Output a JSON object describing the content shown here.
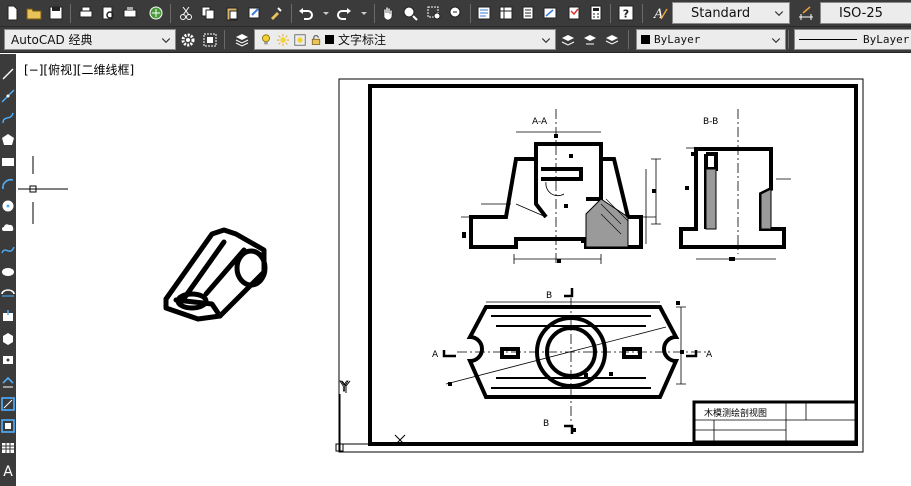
{
  "toolbar_top": {
    "text_style": "Standard",
    "dim_style": "ISO-25",
    "icons": [
      "new-icon",
      "open-icon",
      "save-icon",
      "print-icon",
      "print-preview-icon",
      "plot-icon",
      "publish-icon",
      "cut-icon",
      "copy-icon",
      "paste-icon",
      "match-properties-icon",
      "undo-icon",
      "redo-icon",
      "pan-icon",
      "zoom-realtime-icon",
      "zoom-window-icon",
      "zoom-previous-icon",
      "properties-icon",
      "design-center-icon",
      "tool-palettes-icon",
      "sheet-set-icon",
      "markup-icon",
      "calculator-icon",
      "help-icon",
      "text-style-icon",
      "dim-style-icon"
    ]
  },
  "toolbar_second": {
    "workspace": "AutoCAD 经典",
    "layer": "文字标注",
    "color": "ByLayer",
    "linetype": "ByLayer",
    "icons": [
      "settings-gear-icon",
      "workspace-icon",
      "layer-manager-icon",
      "layer-light-icon",
      "layer-sun-icon",
      "layer-lock-icon",
      "layer-color-icon",
      "make-current-icon",
      "layer-previous-icon",
      "layer-state-icon",
      "color-swatch-icon",
      "linetype-icon"
    ]
  },
  "left_toolbar": {
    "icons": [
      "line-icon",
      "construction-line-icon",
      "polyline-icon",
      "polygon-icon",
      "rectangle-icon",
      "arc-icon",
      "circle-icon",
      "revision-cloud-icon",
      "spline-icon",
      "ellipse-icon",
      "ellipse-arc-icon",
      "insert-block-icon",
      "make-block-icon",
      "point-icon",
      "hatch-icon",
      "gradient-icon",
      "region-icon",
      "table-icon",
      "multiline-text-icon"
    ]
  },
  "canvas": {
    "view_label": "[−][俯视][二维线框]",
    "section_aa": "A-A",
    "section_bb": "B-B",
    "cut_a_left": "A",
    "cut_a_right": "A",
    "cut_b_top": "B",
    "cut_b_bottom": "B",
    "title_block_name": "木模测绘剖视图",
    "ucs_x": "X",
    "ucs_y": "Y"
  }
}
